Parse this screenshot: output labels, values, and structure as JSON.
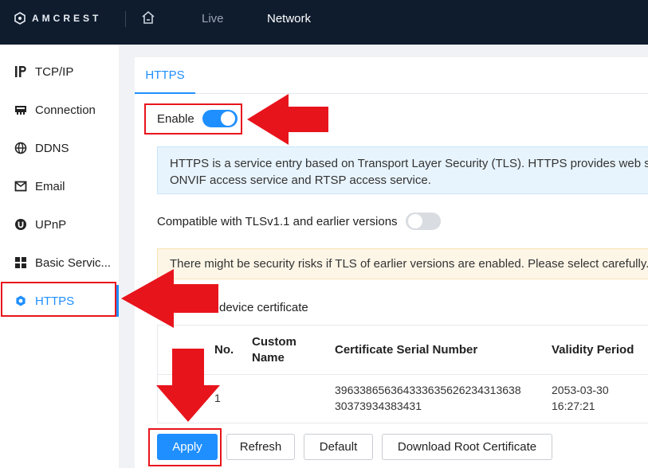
{
  "topbar": {
    "brand": "AMCREST",
    "nav": {
      "live": "Live",
      "network": "Network"
    }
  },
  "sidebar": {
    "items": [
      {
        "label": "TCP/IP",
        "icon": "ip-icon"
      },
      {
        "label": "Connection",
        "icon": "connection-icon"
      },
      {
        "label": "DDNS",
        "icon": "globe-icon"
      },
      {
        "label": "Email",
        "icon": "mail-icon"
      },
      {
        "label": "UPnP",
        "icon": "upnp-icon"
      },
      {
        "label": "Basic Servic...",
        "icon": "grid-icon"
      },
      {
        "label": "HTTPS",
        "icon": "gear-icon",
        "active": true
      }
    ]
  },
  "main": {
    "tab": "HTTPS",
    "enable_label": "Enable",
    "enable_on": true,
    "info_line1": "HTTPS is a service entry based on Transport Layer Security (TLS). HTTPS provides web serv",
    "info_line2": "ONVIF access service and RTSP access service.",
    "compat_label": "Compatible with TLSv1.1 and earlier versions",
    "compat_on": false,
    "warning": "There might be security risks if TLS of earlier versions are enabled. Please select carefully.",
    "cert_label": "device certificate",
    "table": {
      "headers": {
        "no": "No.",
        "custom_name_1": "Custom",
        "custom_name_2": "Name",
        "serial": "Certificate Serial Number",
        "validity": "Validity Period"
      },
      "rows": [
        {
          "no": "1",
          "serial_1": "39633865636433363562623431363",
          "serial_1b": "8",
          "serial_2": "30373934383431",
          "validity_1": "2053-03-30",
          "validity_2": "16:27:21"
        }
      ]
    },
    "buttons": {
      "apply": "Apply",
      "refresh": "Refresh",
      "default": "Default",
      "download": "Download Root Certificate"
    }
  },
  "colors": {
    "accent": "#1f8fff",
    "topbar": "#0f1c2e",
    "annotation": "#e8141c"
  }
}
